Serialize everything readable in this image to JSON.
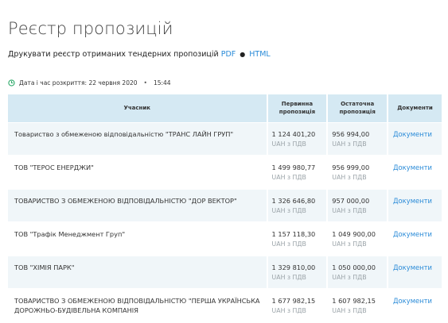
{
  "page": {
    "title": "Реєстр пропозицій",
    "print_prefix": "Друкувати реєстр отриманих тендерних пропозицій",
    "print_pdf": "PDF",
    "print_sep": "●",
    "print_html": "HTML"
  },
  "meta": {
    "opening_label": "Дата і час розкриття: 22 червня 2020",
    "dot": "•",
    "opening_time": "15:44"
  },
  "table": {
    "headers": {
      "participant": "Учасник",
      "first_offer": "Первинна пропозиція",
      "final_offer": "Остаточна пропозиція",
      "documents": "Документи"
    },
    "rows": [
      {
        "participant": "Товариство з обмеженою відповідальністю \"ТРАНС ЛАЙН ГРУП\"",
        "first_amount": "1 124 401,20",
        "first_vat": "UAH з ПДВ",
        "final_amount": "956 994,00",
        "final_vat": "UAH з ПДВ",
        "docs": "Документи"
      },
      {
        "participant": "ТОВ \"ТЕРОС ЕНЕРДЖИ\"",
        "first_amount": "1 499 980,77",
        "first_vat": "UAH з ПДВ",
        "final_amount": "956 999,00",
        "final_vat": "UAH з ПДВ",
        "docs": "Документи"
      },
      {
        "participant": "ТОВАРИСТВО З ОБМЕЖЕНОЮ ВІДПОВІДАЛЬНІСТЮ \"ДОР ВЕКТОР\"",
        "first_amount": "1 326 646,80",
        "first_vat": "UAH з ПДВ",
        "final_amount": "957 000,00",
        "final_vat": "UAH з ПДВ",
        "docs": "Документи"
      },
      {
        "participant": "ТОВ \"Трафік Менеджмент Груп\"",
        "first_amount": "1 157 118,30",
        "first_vat": "UAH з ПДВ",
        "final_amount": "1 049 900,00",
        "final_vat": "UAH з ПДВ",
        "docs": "Документи"
      },
      {
        "participant": "ТОВ \"ХІМІЯ ПАРК\"",
        "first_amount": "1 329 810,00",
        "first_vat": "UAH з ПДВ",
        "final_amount": "1 050 000,00",
        "final_vat": "UAH з ПДВ",
        "docs": "Документи"
      },
      {
        "participant": "ТОВАРИСТВО З ОБМЕЖЕНОЮ ВІДПОВІДАЛЬНІСТЮ \"ПЕРША УКРАЇНСЬКА ДОРОЖНЬО-БУДІВЕЛЬНА КОМПАНІЯ",
        "first_amount": "1 677 982,15",
        "first_vat": "UAH з ПДВ",
        "final_amount": "1 607 982,15",
        "final_vat": "UAH з ПДВ",
        "docs": "Документи"
      }
    ]
  },
  "colors": {
    "accent": "#2a8bd8",
    "clock": "#2eaa6a",
    "header_bg": "#d5e9f3",
    "row_alt_bg": "#f0f6f9"
  },
  "icons": {
    "clock": "clock-icon"
  }
}
